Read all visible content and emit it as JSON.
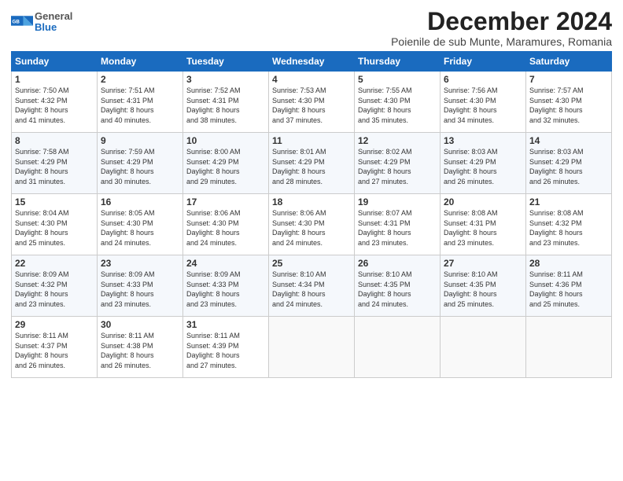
{
  "logo": {
    "general": "General",
    "blue": "Blue"
  },
  "title": "December 2024",
  "subtitle": "Poienile de sub Munte, Maramures, Romania",
  "headers": [
    "Sunday",
    "Monday",
    "Tuesday",
    "Wednesday",
    "Thursday",
    "Friday",
    "Saturday"
  ],
  "weeks": [
    [
      {
        "day": "1",
        "info": "Sunrise: 7:50 AM\nSunset: 4:32 PM\nDaylight: 8 hours\nand 41 minutes."
      },
      {
        "day": "2",
        "info": "Sunrise: 7:51 AM\nSunset: 4:31 PM\nDaylight: 8 hours\nand 40 minutes."
      },
      {
        "day": "3",
        "info": "Sunrise: 7:52 AM\nSunset: 4:31 PM\nDaylight: 8 hours\nand 38 minutes."
      },
      {
        "day": "4",
        "info": "Sunrise: 7:53 AM\nSunset: 4:30 PM\nDaylight: 8 hours\nand 37 minutes."
      },
      {
        "day": "5",
        "info": "Sunrise: 7:55 AM\nSunset: 4:30 PM\nDaylight: 8 hours\nand 35 minutes."
      },
      {
        "day": "6",
        "info": "Sunrise: 7:56 AM\nSunset: 4:30 PM\nDaylight: 8 hours\nand 34 minutes."
      },
      {
        "day": "7",
        "info": "Sunrise: 7:57 AM\nSunset: 4:30 PM\nDaylight: 8 hours\nand 32 minutes."
      }
    ],
    [
      {
        "day": "8",
        "info": "Sunrise: 7:58 AM\nSunset: 4:29 PM\nDaylight: 8 hours\nand 31 minutes."
      },
      {
        "day": "9",
        "info": "Sunrise: 7:59 AM\nSunset: 4:29 PM\nDaylight: 8 hours\nand 30 minutes."
      },
      {
        "day": "10",
        "info": "Sunrise: 8:00 AM\nSunset: 4:29 PM\nDaylight: 8 hours\nand 29 minutes."
      },
      {
        "day": "11",
        "info": "Sunrise: 8:01 AM\nSunset: 4:29 PM\nDaylight: 8 hours\nand 28 minutes."
      },
      {
        "day": "12",
        "info": "Sunrise: 8:02 AM\nSunset: 4:29 PM\nDaylight: 8 hours\nand 27 minutes."
      },
      {
        "day": "13",
        "info": "Sunrise: 8:03 AM\nSunset: 4:29 PM\nDaylight: 8 hours\nand 26 minutes."
      },
      {
        "day": "14",
        "info": "Sunrise: 8:03 AM\nSunset: 4:29 PM\nDaylight: 8 hours\nand 26 minutes."
      }
    ],
    [
      {
        "day": "15",
        "info": "Sunrise: 8:04 AM\nSunset: 4:30 PM\nDaylight: 8 hours\nand 25 minutes."
      },
      {
        "day": "16",
        "info": "Sunrise: 8:05 AM\nSunset: 4:30 PM\nDaylight: 8 hours\nand 24 minutes."
      },
      {
        "day": "17",
        "info": "Sunrise: 8:06 AM\nSunset: 4:30 PM\nDaylight: 8 hours\nand 24 minutes."
      },
      {
        "day": "18",
        "info": "Sunrise: 8:06 AM\nSunset: 4:30 PM\nDaylight: 8 hours\nand 24 minutes."
      },
      {
        "day": "19",
        "info": "Sunrise: 8:07 AM\nSunset: 4:31 PM\nDaylight: 8 hours\nand 23 minutes."
      },
      {
        "day": "20",
        "info": "Sunrise: 8:08 AM\nSunset: 4:31 PM\nDaylight: 8 hours\nand 23 minutes."
      },
      {
        "day": "21",
        "info": "Sunrise: 8:08 AM\nSunset: 4:32 PM\nDaylight: 8 hours\nand 23 minutes."
      }
    ],
    [
      {
        "day": "22",
        "info": "Sunrise: 8:09 AM\nSunset: 4:32 PM\nDaylight: 8 hours\nand 23 minutes."
      },
      {
        "day": "23",
        "info": "Sunrise: 8:09 AM\nSunset: 4:33 PM\nDaylight: 8 hours\nand 23 minutes."
      },
      {
        "day": "24",
        "info": "Sunrise: 8:09 AM\nSunset: 4:33 PM\nDaylight: 8 hours\nand 23 minutes."
      },
      {
        "day": "25",
        "info": "Sunrise: 8:10 AM\nSunset: 4:34 PM\nDaylight: 8 hours\nand 24 minutes."
      },
      {
        "day": "26",
        "info": "Sunrise: 8:10 AM\nSunset: 4:35 PM\nDaylight: 8 hours\nand 24 minutes."
      },
      {
        "day": "27",
        "info": "Sunrise: 8:10 AM\nSunset: 4:35 PM\nDaylight: 8 hours\nand 25 minutes."
      },
      {
        "day": "28",
        "info": "Sunrise: 8:11 AM\nSunset: 4:36 PM\nDaylight: 8 hours\nand 25 minutes."
      }
    ],
    [
      {
        "day": "29",
        "info": "Sunrise: 8:11 AM\nSunset: 4:37 PM\nDaylight: 8 hours\nand 26 minutes."
      },
      {
        "day": "30",
        "info": "Sunrise: 8:11 AM\nSunset: 4:38 PM\nDaylight: 8 hours\nand 26 minutes."
      },
      {
        "day": "31",
        "info": "Sunrise: 8:11 AM\nSunset: 4:39 PM\nDaylight: 8 hours\nand 27 minutes."
      },
      null,
      null,
      null,
      null
    ]
  ]
}
